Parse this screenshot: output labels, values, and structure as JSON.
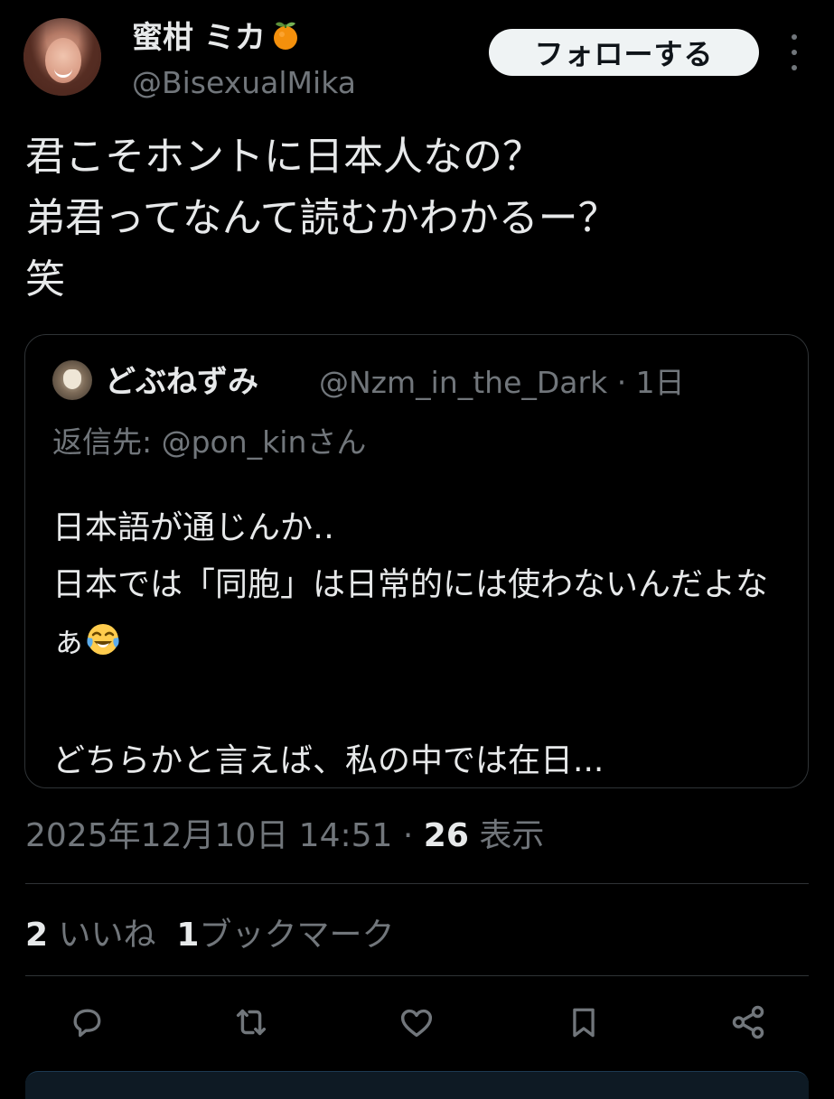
{
  "author": {
    "display_name": "蜜柑 ミカ",
    "emoji": "tangerine-emoji",
    "handle": "@BisexualMika"
  },
  "header": {
    "follow_label": "フォローする"
  },
  "tweet": {
    "text": "君こそホントに日本人なの？\n弟君ってなんて読むかわかるー？\n笑"
  },
  "quoted_tweet": {
    "display_name": "どぶねずみ",
    "handle_and_time": "@Nzm_in_the_Dark · 1日",
    "reply_to": "返信先: @pon_kinさん",
    "text_before_emoji": "日本語が通じんか‥\n日本では「同胞」は日常的には使わないんだよなぁ",
    "emoji": "face-with-tears-of-joy-emoji",
    "text_after_emoji": "\n\nどちらかと言えば、私の中では在日..."
  },
  "meta": {
    "timestamp": "2025年12月10日 14:51",
    "separator": " · ",
    "views_count": "26",
    "views_label": " 表示"
  },
  "stats": {
    "likes_count": "2",
    "likes_label": " いいね",
    "bookmarks_count": "1",
    "bookmarks_label": "ブックマーク"
  },
  "actions": [
    "reply-icon",
    "repost-icon",
    "like-icon",
    "bookmark-icon",
    "share-icon"
  ],
  "colors": {
    "background": "#000000",
    "text_primary": "#e7e9ea",
    "text_secondary": "#71767b",
    "border": "#2f3336",
    "follow_bg": "#eff3f4"
  }
}
